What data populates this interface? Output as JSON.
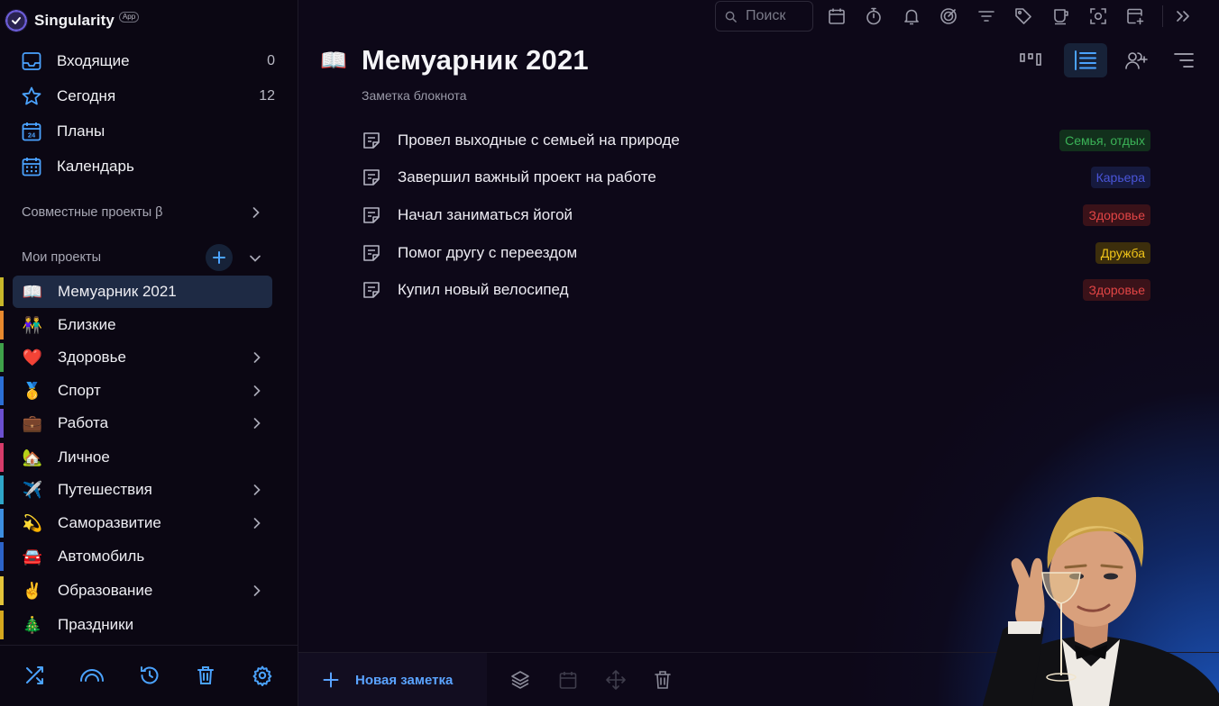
{
  "app": {
    "name": "Singularity",
    "badge": "App"
  },
  "nav": [
    {
      "label": "Входящие",
      "count": "0",
      "icon": "inbox-icon"
    },
    {
      "label": "Сегодня",
      "count": "12",
      "icon": "star-icon"
    },
    {
      "label": "Планы",
      "count": "",
      "icon": "calendar-24-icon"
    },
    {
      "label": "Календарь",
      "count": "",
      "icon": "calendar-grid-icon"
    }
  ],
  "shared_projects": {
    "label": "Совместные проекты β"
  },
  "my_projects": {
    "label": "Мои проекты"
  },
  "projects": [
    {
      "label": "Мемуарник 2021",
      "emoji": "📖",
      "color": "#c8b62a",
      "expandable": false,
      "active": true
    },
    {
      "label": "Близкие",
      "emoji": "👫",
      "color": "#e8892e",
      "expandable": false
    },
    {
      "label": "Здоровье",
      "emoji": "❤️",
      "color": "#3fa14a",
      "expandable": true
    },
    {
      "label": "Спорт",
      "emoji": "🥇",
      "color": "#2b6fd6",
      "expandable": true
    },
    {
      "label": "Работа",
      "emoji": "💼",
      "color": "#6b4fd0",
      "expandable": true
    },
    {
      "label": "Личное",
      "emoji": "🏡",
      "color": "#d63b6a",
      "expandable": false
    },
    {
      "label": "Путешествия",
      "emoji": "✈️",
      "color": "#2fa6c9",
      "expandable": true
    },
    {
      "label": "Саморазвитие",
      "emoji": "💫",
      "color": "#3d8ee0",
      "expandable": true
    },
    {
      "label": "Автомобиль",
      "emoji": "🚘",
      "color": "#2c63c9",
      "expandable": false
    },
    {
      "label": "Образование",
      "emoji": "✌️",
      "color": "#e3c43a",
      "expandable": true
    },
    {
      "label": "Праздники",
      "emoji": "🎄",
      "color": "#d6a81e",
      "expandable": false
    }
  ],
  "search": {
    "placeholder": "Поиск"
  },
  "page": {
    "title": "Мемуарник 2021",
    "subtitle": "Заметка блокнота",
    "icon": "📖"
  },
  "notes": [
    {
      "text": "Провел выходные с семьей на природе",
      "tag": "Семья, отдых",
      "tag_color": "#3bb257",
      "tag_bg": "#12301c"
    },
    {
      "text": "Завершил важный проект на работе",
      "tag": "Карьера",
      "tag_color": "#4a55d8",
      "tag_bg": "#161a3e"
    },
    {
      "text": "Начал заниматься йогой",
      "tag": "Здоровье",
      "tag_color": "#e24545",
      "tag_bg": "#3a1219"
    },
    {
      "text": "Помог другу с переездом",
      "tag": "Дружба",
      "tag_color": "#f0c419",
      "tag_bg": "#3c2e0c"
    },
    {
      "text": "Купил новый велосипед",
      "tag": "Здоровье",
      "tag_color": "#e24545",
      "tag_bg": "#3a1219"
    }
  ],
  "bottom": {
    "new_note_label": "Новая заметка"
  },
  "colors": {
    "accent": "#5aa3ff",
    "active_item_bg": "#1e2a44",
    "sidebar_bg": "#0b0713",
    "main_bg": "#0d0818"
  }
}
